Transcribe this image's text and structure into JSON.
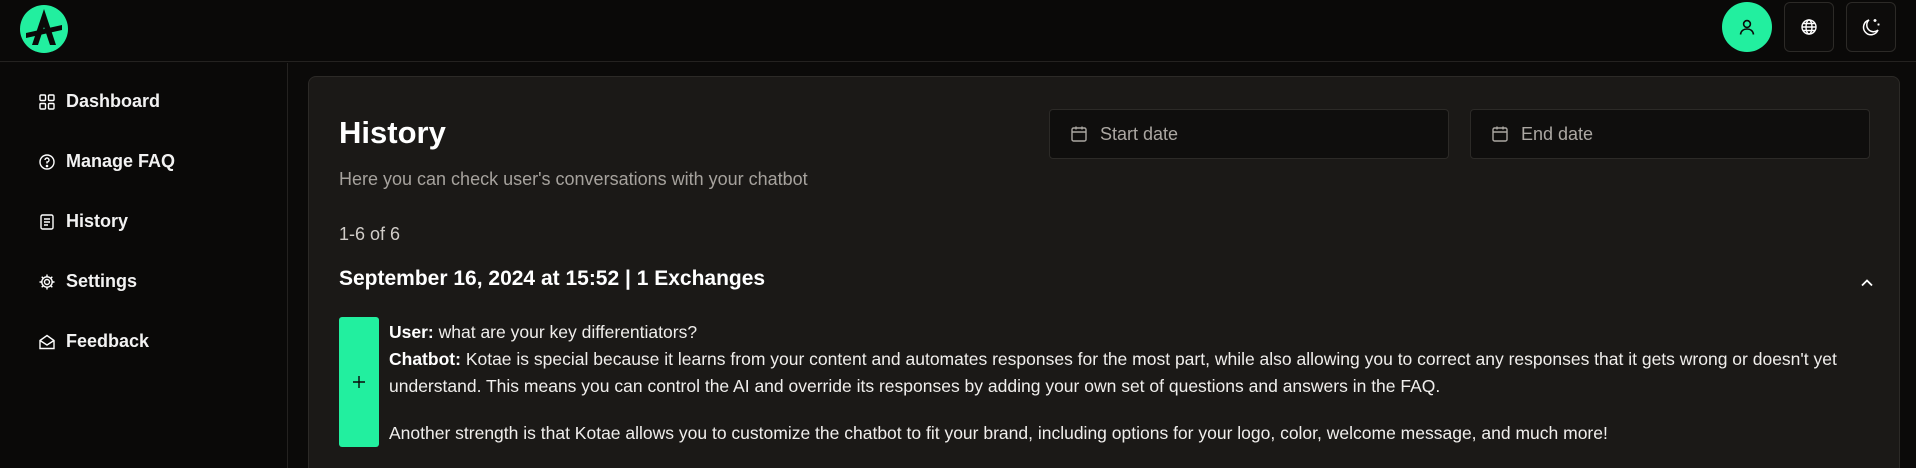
{
  "brand": {
    "logo_icon": "kotae-logo-icon",
    "accent_color": "#22ef9f"
  },
  "topbar": {
    "user_icon": "user-icon",
    "language_icon": "globe-icon",
    "theme_icon": "moon-stars-icon"
  },
  "sidebar": {
    "items": [
      {
        "label": "Dashboard",
        "icon": "grid-icon"
      },
      {
        "label": "Manage FAQ",
        "icon": "question-circle-icon"
      },
      {
        "label": "History",
        "icon": "document-icon"
      },
      {
        "label": "Settings",
        "icon": "gear-icon"
      },
      {
        "label": "Feedback",
        "icon": "envelope-open-icon"
      }
    ]
  },
  "main": {
    "title": "History",
    "subtitle": "Here you can check user's conversations with your chatbot",
    "start_date": {
      "placeholder": "Start date",
      "value": ""
    },
    "end_date": {
      "placeholder": "End date",
      "value": ""
    },
    "count": "1-6 of 6",
    "conversation": {
      "header": "September 16, 2024 at 15:52 | 1 Exchanges",
      "user_label": "User:",
      "user_text": "what are your key differentiators?",
      "bot_label": "Chatbot:",
      "bot_text_1": "Kotae is special because it learns from your content and automates responses for the most part, while also allowing you to correct any responses that it gets wrong or doesn't yet understand. This means you can control the AI and override its responses by adding your own set of questions and answers in the FAQ.",
      "bot_text_2": "Another strength is that Kotae allows you to customize the chatbot to fit your brand, including options for your logo, color, welcome message, and much more!"
    }
  }
}
